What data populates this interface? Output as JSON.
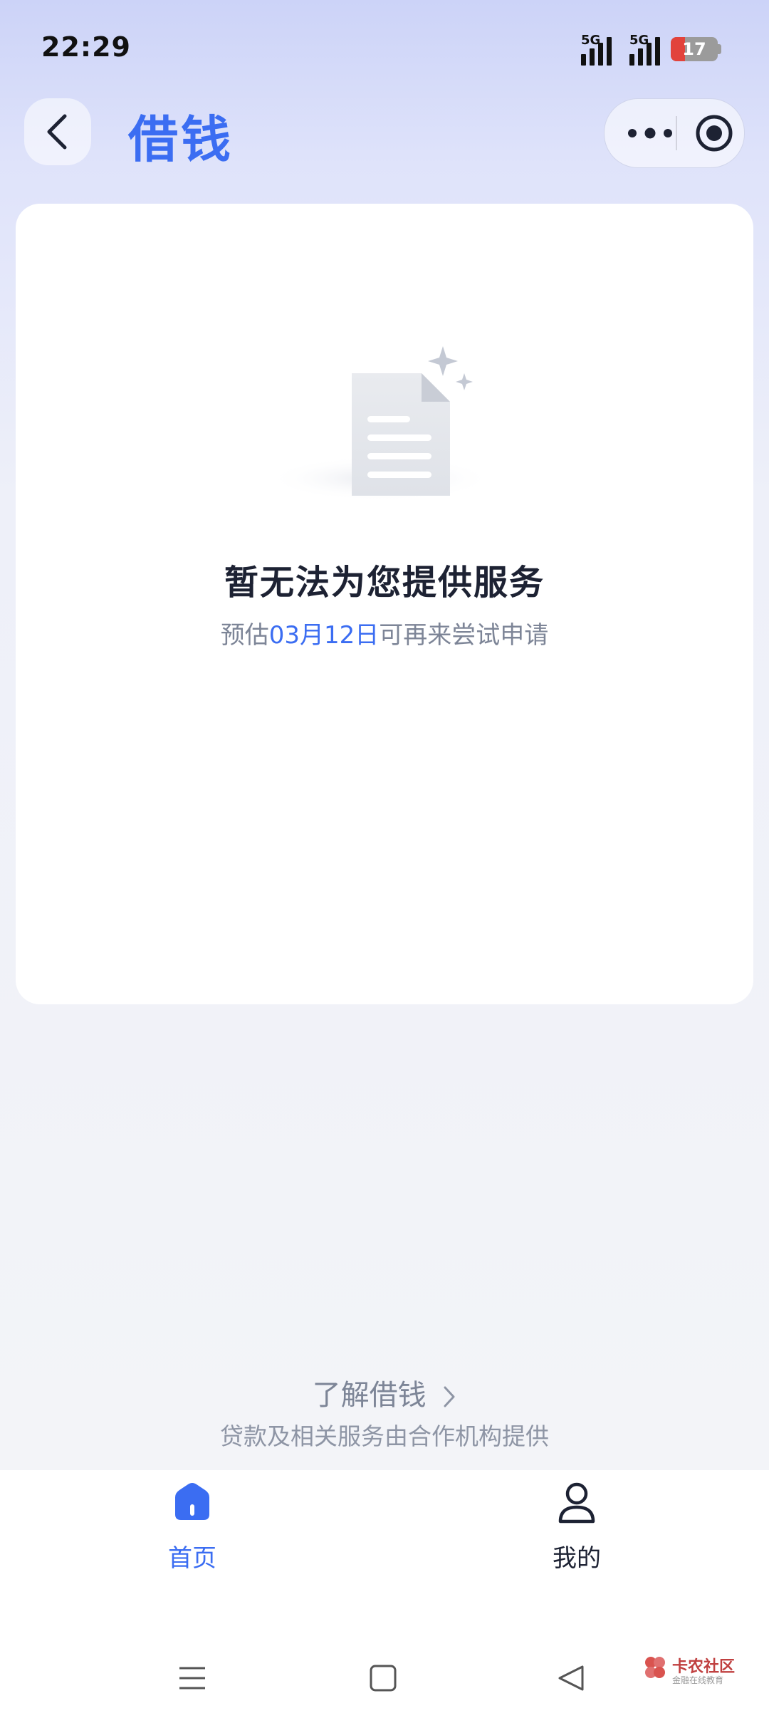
{
  "status_bar": {
    "time": "22:29",
    "signal1_label": "5G",
    "signal2_label": "5G",
    "battery_level": "17"
  },
  "header": {
    "title": "借钱"
  },
  "notice": {
    "title": "暂无法为您提供服务",
    "sub_prefix": "预估",
    "sub_date": "03月12日",
    "sub_suffix": "可再来尝试申请"
  },
  "footer": {
    "learn_more": "了解借钱",
    "provider_note": "贷款及相关服务由合作机构提供"
  },
  "tabs": [
    {
      "label": "首页",
      "icon": "home-icon",
      "active": true
    },
    {
      "label": "我的",
      "icon": "person-icon",
      "active": false
    }
  ],
  "watermark": {
    "name": "卡农社区",
    "tagline": "金融在线教育"
  },
  "colors": {
    "accent": "#3b6df2",
    "muted": "#7d8597",
    "dark": "#1d2233"
  }
}
